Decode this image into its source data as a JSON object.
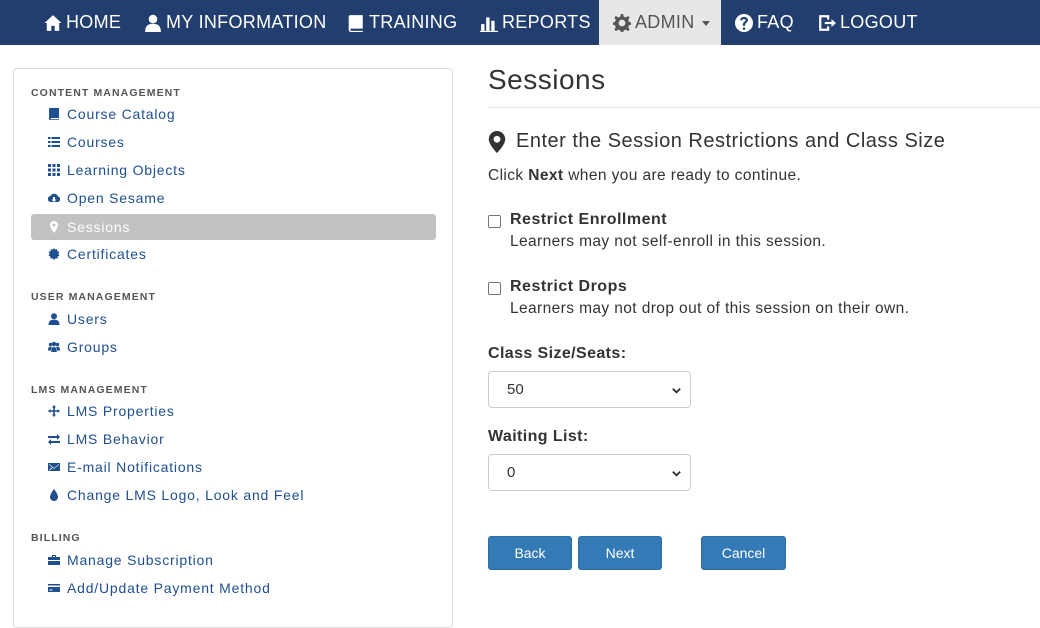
{
  "nav": {
    "home": "HOME",
    "my_information": "MY INFORMATION",
    "training": "TRAINING",
    "reports": "REPORTS",
    "admin": "ADMIN",
    "faq": "FAQ",
    "logout": "LOGOUT",
    "active": "ADMIN"
  },
  "sidebar": {
    "content_management": {
      "heading": "CONTENT MANAGEMENT",
      "items": [
        {
          "label": "Course Catalog",
          "icon": "book-icon"
        },
        {
          "label": "Courses",
          "icon": "list-icon"
        },
        {
          "label": "Learning Objects",
          "icon": "grid-icon"
        },
        {
          "label": "Open Sesame",
          "icon": "cloud-download-icon"
        },
        {
          "label": "Sessions",
          "icon": "map-marker-icon",
          "active": true
        },
        {
          "label": "Certificates",
          "icon": "certificate-icon"
        }
      ]
    },
    "user_management": {
      "heading": "USER MANAGEMENT",
      "items": [
        {
          "label": "Users",
          "icon": "user-icon"
        },
        {
          "label": "Groups",
          "icon": "group-icon"
        }
      ]
    },
    "lms_management": {
      "heading": "LMS MANAGEMENT",
      "items": [
        {
          "label": "LMS Properties",
          "icon": "move-icon"
        },
        {
          "label": "LMS Behavior",
          "icon": "transfer-icon"
        },
        {
          "label": "E-mail Notifications",
          "icon": "envelope-icon"
        },
        {
          "label": "Change LMS Logo, Look and Feel",
          "icon": "tint-icon"
        }
      ]
    },
    "billing": {
      "heading": "BILLING",
      "items": [
        {
          "label": "Manage Subscription",
          "icon": "briefcase-icon"
        },
        {
          "label": "Add/Update Payment Method",
          "icon": "credit-card-icon"
        }
      ]
    }
  },
  "main": {
    "title": "Sessions",
    "step_heading": "Enter the Session Restrictions and Class Size",
    "instruction": {
      "before": "Click ",
      "bold": "Next",
      "after": " when you are ready to continue."
    },
    "options": [
      {
        "title": "Restrict Enrollment",
        "description": "Learners may not self-enroll in this session.",
        "checked": false
      },
      {
        "title": "Restrict Drops",
        "description": "Learners may not drop out of this session on their own.",
        "checked": false
      }
    ],
    "class_size": {
      "label": "Class Size/Seats:",
      "value": "50"
    },
    "waiting_list": {
      "label": "Waiting List:",
      "value": "0"
    },
    "buttons": {
      "back": "Back",
      "next": "Next",
      "cancel": "Cancel"
    }
  },
  "colors": {
    "nav_bg": "#223e6e",
    "nav_active_bg": "#e7e7e7",
    "link": "#1f4f8f",
    "sidebar_active_bg": "#c2c2c2",
    "button_primary": "#337ab7"
  }
}
